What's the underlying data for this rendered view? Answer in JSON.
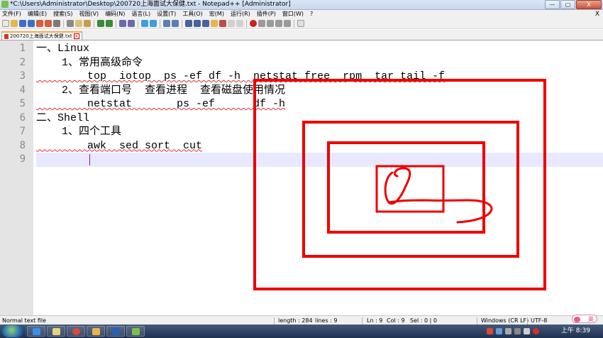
{
  "window": {
    "title": "*C:\\Users\\Administrator\\Desktop\\200720上海面试大保健.txt - Notepad++ [Administrator]",
    "min_label": "—",
    "max_label": "▢",
    "close_label": "X"
  },
  "menu": {
    "items": [
      "文件(F)",
      "编辑(E)",
      "搜索(S)",
      "视图(V)",
      "编码(N)",
      "语言(L)",
      "设置(T)",
      "工具(O)",
      "宏(M)",
      "运行(R)",
      "插件(P)",
      "窗口(W)",
      "?"
    ],
    "close": "X"
  },
  "tab": {
    "label": "200720上海面试大保健.txt"
  },
  "editor": {
    "line_numbers": [
      "1",
      "2",
      "3",
      "4",
      "5",
      "6",
      "7",
      "8",
      "9"
    ],
    "lines": [
      "一、Linux",
      "    1、常用高级命令",
      "        top  iotop  ps -ef df -h  netstat free  rpm  tar tail -f",
      "    2、查看端口号  查看进程  查看磁盘使用情况",
      "        netstat       ps -ef      df -h",
      "二、Shell",
      "    1、四个工具",
      "        awk  sed sort  cut",
      ""
    ],
    "current_line": 9
  },
  "status": {
    "file_type": "Normal text file",
    "length": "length : 284",
    "lines": "lines : 9",
    "ln": "Ln : 9",
    "col": "Col : 9",
    "sel": "Sel : 0 | 0",
    "eol": "Windows (CR LF)",
    "encoding": "UTF-8"
  },
  "taskbar": {
    "clock": "上午 8:39",
    "ime_label": "英"
  },
  "colors": {
    "drawing_red": "#ee0000",
    "current_line": "#e8e8ff",
    "caret": "#8b00ff"
  }
}
